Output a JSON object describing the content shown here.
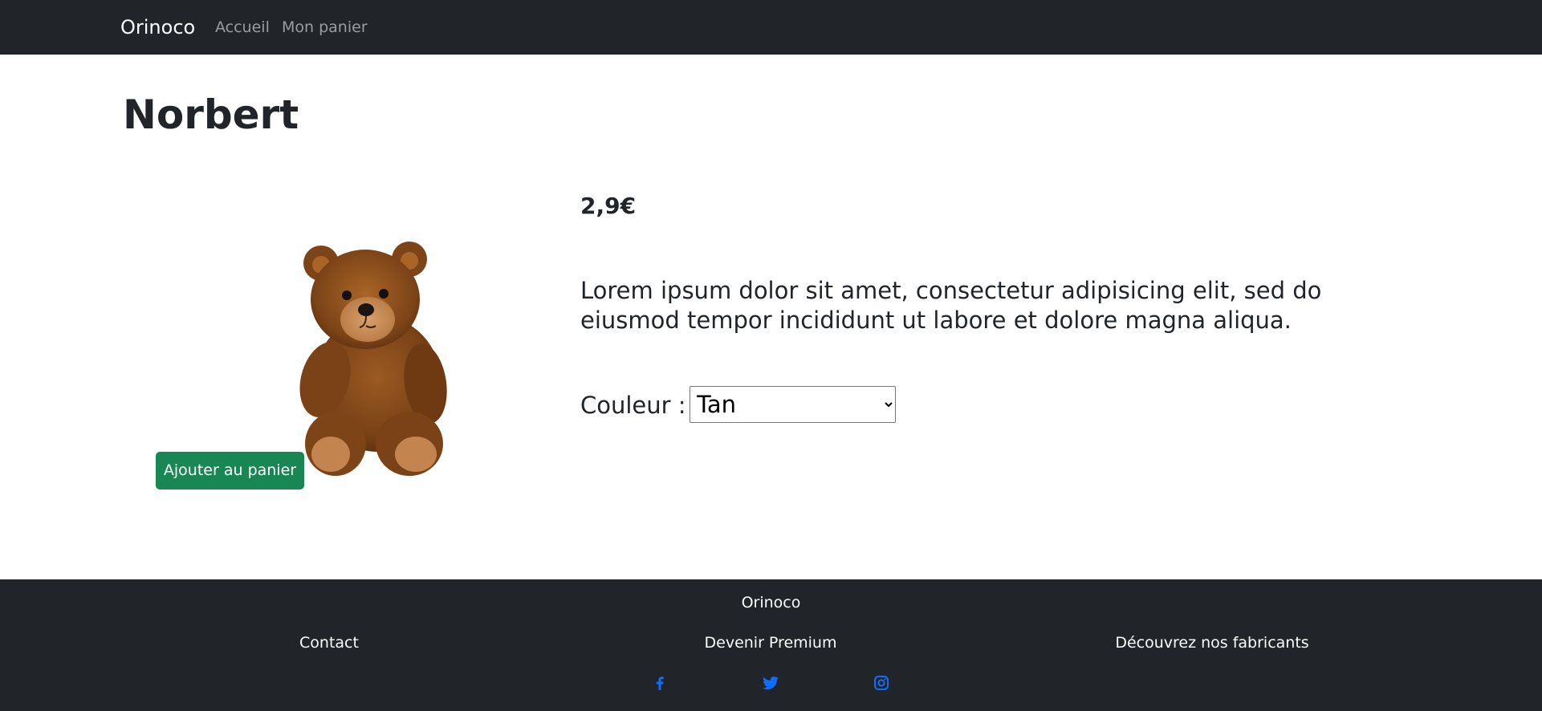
{
  "navbar": {
    "brand": "Orinoco",
    "links": [
      {
        "label": "Accueil"
      },
      {
        "label": "Mon panier"
      }
    ],
    "background": "#212529",
    "link_color": "#9a9da1"
  },
  "product": {
    "name": "Norbert",
    "price": "2,9€",
    "description": "Lorem ipsum dolor sit amet, consectetur adipisicing elit, sed do eiusmod tempor incididunt ut labore et dolore magna aliqua.",
    "color_label": "Couleur :",
    "selected_color": "Tan",
    "add_button_label": "Ajouter au panier",
    "add_button_color": "#198754",
    "image_icon": "teddy-bear-photo"
  },
  "footer": {
    "brand": "Orinoco",
    "links": [
      {
        "label": "Contact"
      },
      {
        "label": "Devenir Premium"
      },
      {
        "label": "Découvrez nos fabricants"
      }
    ],
    "social": [
      {
        "icon": "facebook-icon"
      },
      {
        "icon": "twitter-icon"
      },
      {
        "icon": "instagram-icon"
      }
    ],
    "social_color": "#0d6efd"
  }
}
